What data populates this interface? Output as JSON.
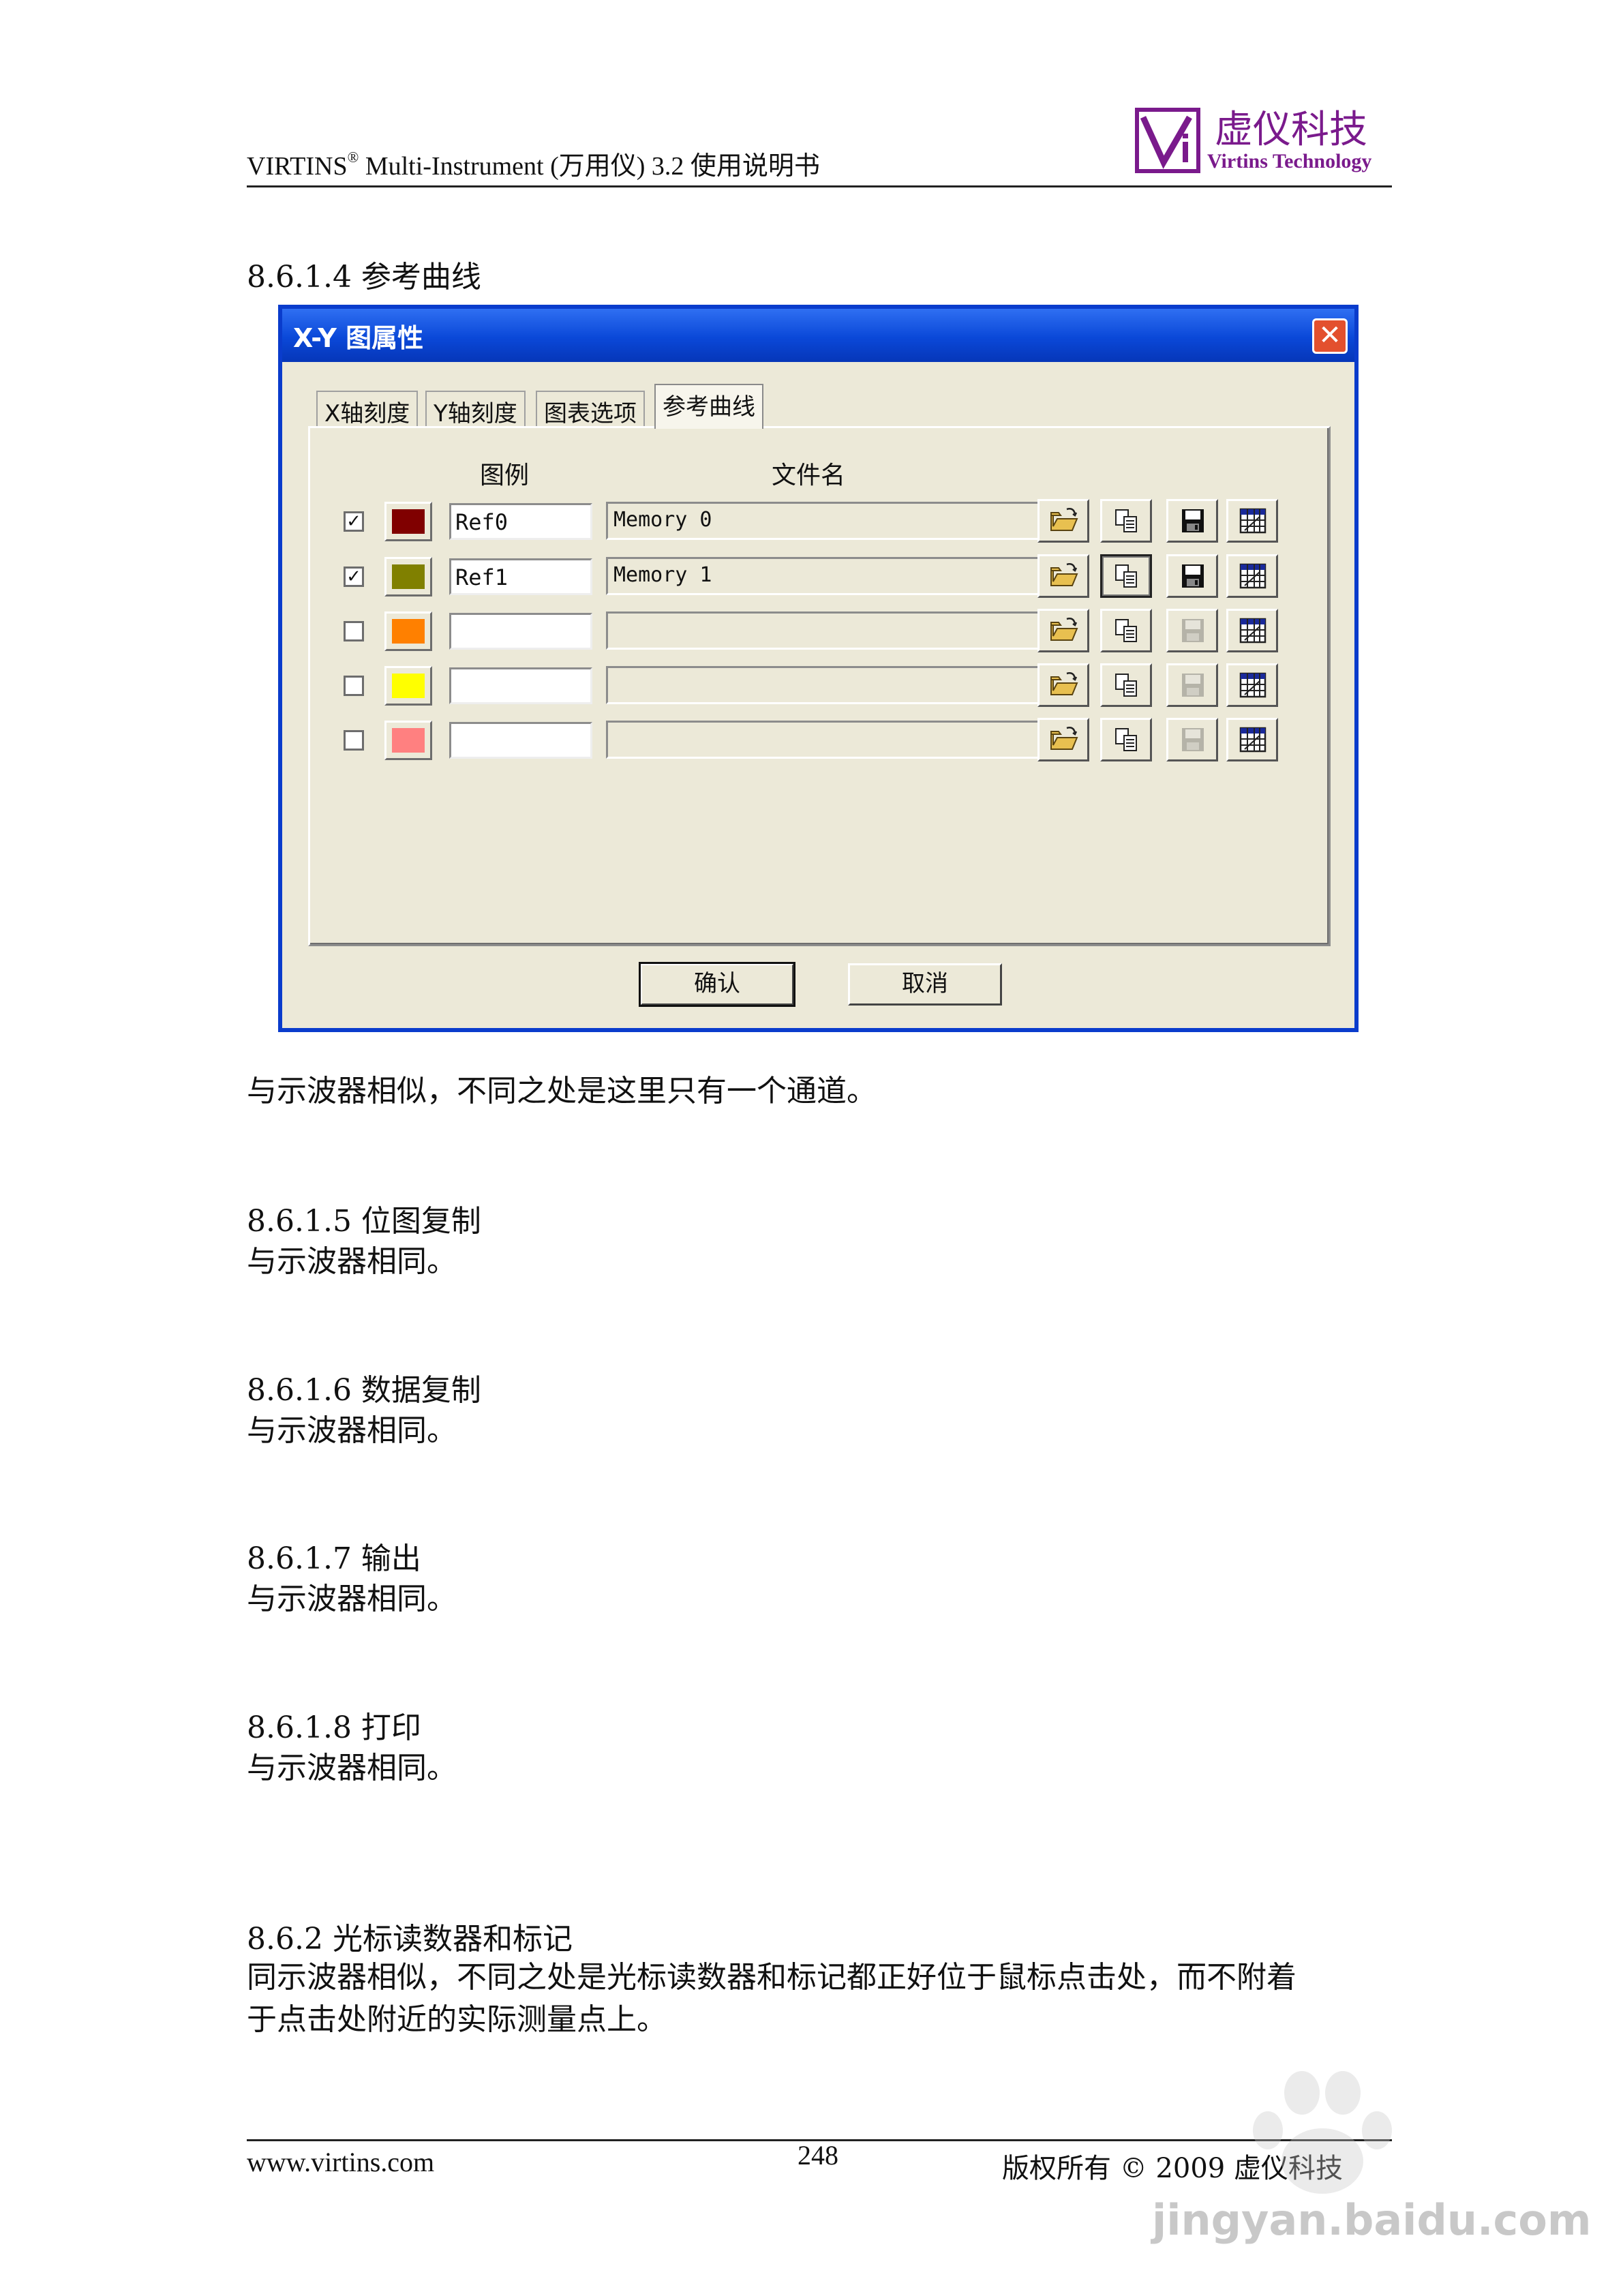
{
  "header": {
    "doc_title": "VIRTINS",
    "reg_mark": "®",
    "doc_subtitle": " Multi-Instrument (万用仪) 3.2 使用说明书",
    "logo_cn": "虚仪科技",
    "logo_en": "Virtins Technology",
    "logo_color": "#7a1a8c"
  },
  "sections": [
    {
      "heading": "8.6.1.4 参考曲线",
      "text": "与示波器相似，不同之处是这里只有一个通道。"
    },
    {
      "heading": "8.6.1.5 位图复制",
      "text": "与示波器相同。"
    },
    {
      "heading": "8.6.1.6 数据复制",
      "text": "与示波器相同。"
    },
    {
      "heading": "8.6.1.7 输出",
      "text": "与示波器相同。"
    },
    {
      "heading": "8.6.1.8 打印",
      "text": "与示波器相同。"
    },
    {
      "heading": "8.6.2 光标读数器和标记",
      "text_lines": [
        "同示波器相似，不同之处是光标读数器和标记都正好位于鼠标点击处，而不附着",
        "于点击处附近的实际测量点上。"
      ]
    }
  ],
  "dialog": {
    "title": "X-Y 图属性",
    "close_label": "✕",
    "tabs": [
      "X轴刻度",
      "Y轴刻度",
      "图表选项",
      "参考曲线"
    ],
    "active_tab": "参考曲线",
    "col_legend": "图例",
    "col_filename": "文件名",
    "rows": [
      {
        "checked": true,
        "check_mark": "✓",
        "color": "#800000",
        "legend": "Ref0",
        "filename": "Memory 0",
        "save_enabled": true,
        "copy_pressed": false
      },
      {
        "checked": true,
        "check_mark": "✓",
        "color": "#808000",
        "legend": "Ref1",
        "filename": "Memory 1",
        "save_enabled": true,
        "copy_pressed": true
      },
      {
        "checked": false,
        "check_mark": "",
        "color": "#ff8000",
        "legend": "",
        "filename": "",
        "save_enabled": false,
        "copy_pressed": false
      },
      {
        "checked": false,
        "check_mark": "",
        "color": "#ffff00",
        "legend": "",
        "filename": "",
        "save_enabled": false,
        "copy_pressed": false
      },
      {
        "checked": false,
        "check_mark": "",
        "color": "#ff8080",
        "legend": "",
        "filename": "",
        "save_enabled": false,
        "copy_pressed": false
      }
    ],
    "ok_label": "确认",
    "cancel_label": "取消"
  },
  "footer": {
    "url": "www.virtins.com",
    "page": "248",
    "copyright": "版权所有 © 2009 虚仪科技"
  },
  "watermark": {
    "text": "jingyan.baidu.com"
  }
}
